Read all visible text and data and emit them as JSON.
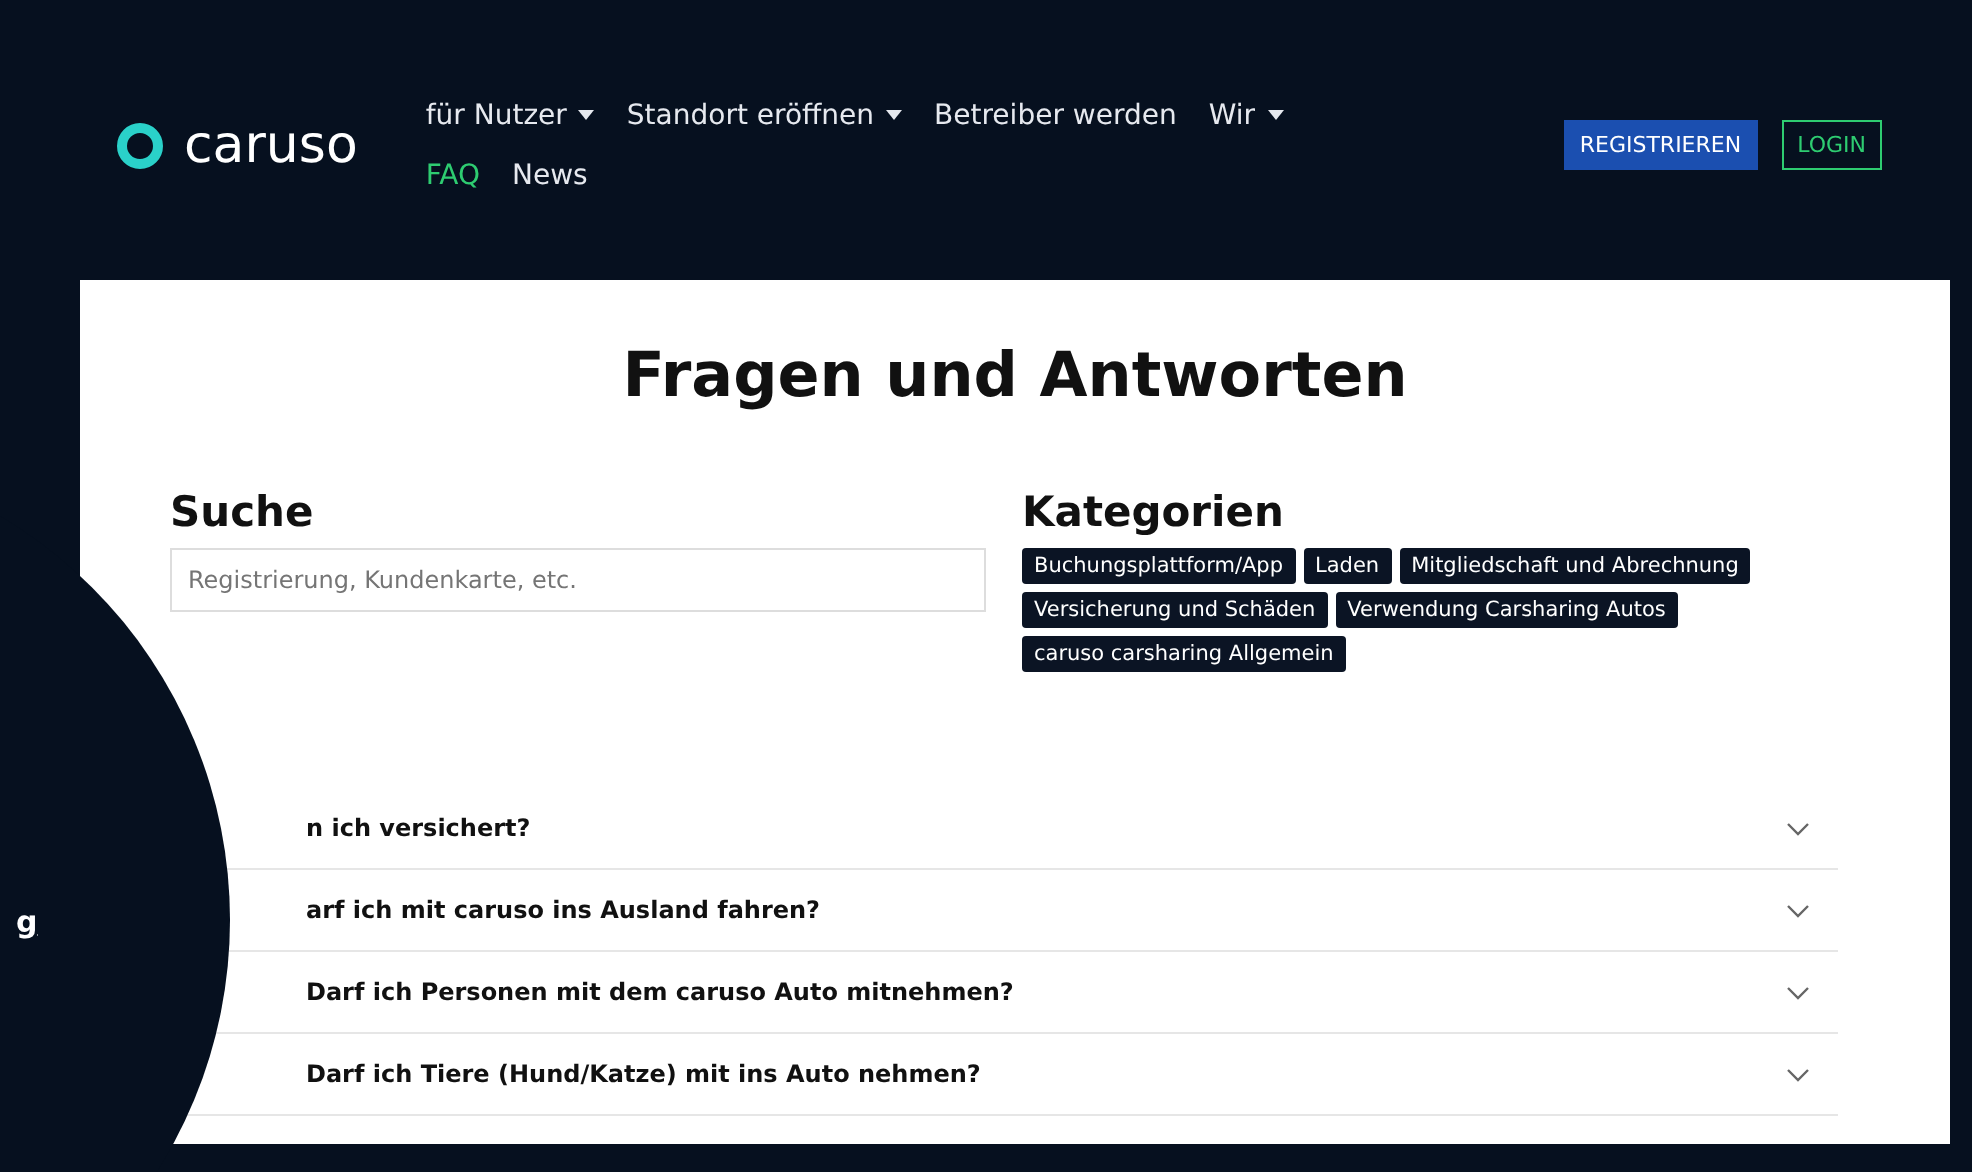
{
  "header": {
    "logo_text": "caruso",
    "nav": [
      {
        "label": "für Nutzer",
        "dropdown": true,
        "selected": false
      },
      {
        "label": "Standort eröffnen",
        "dropdown": true,
        "selected": false
      },
      {
        "label": "Betreiber werden",
        "dropdown": false,
        "selected": false
      },
      {
        "label": "Wir",
        "dropdown": true,
        "selected": false
      },
      {
        "label": "FAQ",
        "dropdown": false,
        "selected": true
      },
      {
        "label": "News",
        "dropdown": false,
        "selected": false
      }
    ],
    "buttons": [
      {
        "label": "REGISTRIEREN",
        "kind": "filled"
      },
      {
        "label": "LOGIN",
        "kind": "outline"
      }
    ]
  },
  "page_title": "Fragen und Antworten",
  "search": {
    "heading": "Suche",
    "placeholder": "Registrierung, Kundenkarte, etc."
  },
  "categories": {
    "heading": "Kategorien",
    "tags": [
      "Buchungsplattform/App",
      "Laden",
      "Mitgliedschaft und Abrechnung",
      "Versicherung und Schäden",
      "Verwendung Carsharing Autos",
      "caruso carsharing Allgemein"
    ]
  },
  "questions": [
    {
      "text": "n ich versichert?",
      "expanded": false
    },
    {
      "text": "arf ich mit caruso ins Ausland fahren?",
      "expanded": false
    },
    {
      "text": "Darf ich Personen mit dem caruso Auto mitnehmen?",
      "expanded": false
    },
    {
      "text": "Darf ich Tiere (Hund/Katze) mit ins Auto nehmen?",
      "expanded": false
    }
  ],
  "overlay": {
    "text": "g"
  }
}
